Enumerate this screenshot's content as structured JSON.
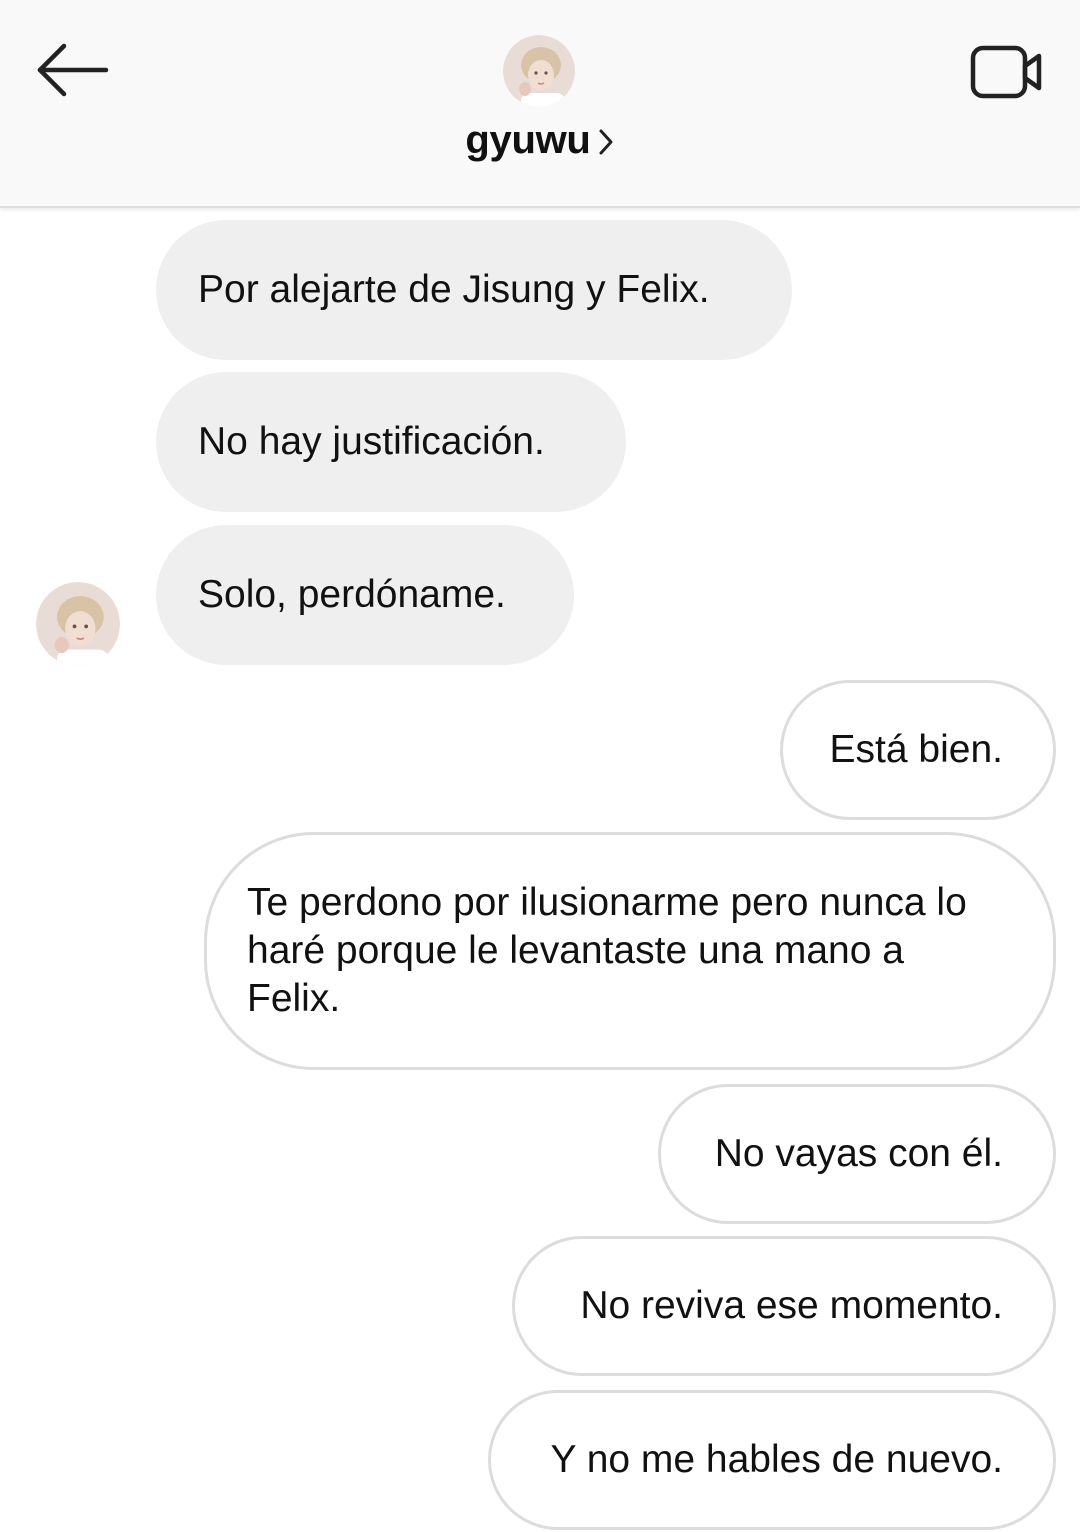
{
  "header": {
    "username": "gyuwu",
    "back_icon": "arrow-left-icon",
    "video_icon": "video-call-icon",
    "avatar_icon": "profile-avatar"
  },
  "messages": [
    {
      "side": "received",
      "text": "Por alejarte de Jisung y Felix."
    },
    {
      "side": "received",
      "text": "No hay justificación."
    },
    {
      "side": "received",
      "text": "Solo, perdóname."
    },
    {
      "side": "sent",
      "text": "Está bien."
    },
    {
      "side": "sent",
      "text": "Te perdono por ilusionarme pero nunca lo haré porque le levantaste una mano a Felix."
    },
    {
      "side": "sent",
      "text": "No vayas con él."
    },
    {
      "side": "sent",
      "text": "No reviva ese momento."
    },
    {
      "side": "sent",
      "text": "Y no me hables de nuevo."
    }
  ],
  "colors": {
    "header_bg": "#f9f9f9",
    "received_bubble": "#efefef",
    "sent_border": "#dcdcdc",
    "text": "#111111"
  }
}
